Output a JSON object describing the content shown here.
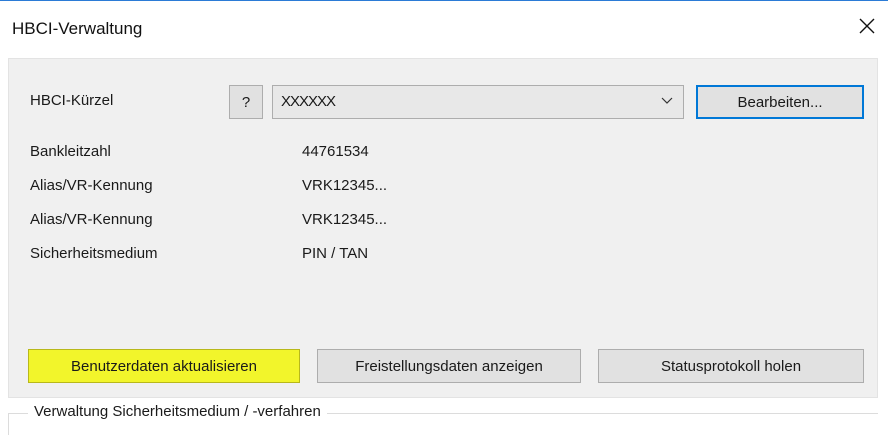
{
  "window": {
    "title": "HBCI-Verwaltung"
  },
  "form": {
    "kuerzel_label": "HBCI-Kürzel",
    "help_label": "?",
    "kuerzel_value": "XXXXXX",
    "edit_button": "Bearbeiten...",
    "rows": [
      {
        "label": "Bankleitzahl",
        "value": "44761534"
      },
      {
        "label": "Alias/VR-Kennung",
        "value": "VRK12345..."
      },
      {
        "label": "Alias/VR-Kennung",
        "value": "VRK12345..."
      },
      {
        "label": "Sicherheitsmedium",
        "value": "PIN / TAN"
      }
    ]
  },
  "actions": {
    "update_user_data": "Benutzerdaten aktualisieren",
    "show_exemption_data": "Freistellungsdaten anzeigen",
    "fetch_status_log": "Statusprotokoll holen"
  },
  "group": {
    "legend": "Verwaltung Sicherheitsmedium / -verfahren"
  },
  "colors": {
    "highlight": "#f2f52b",
    "focus_border": "#0078d7",
    "titlebar_accent": "#2b7bd6"
  }
}
